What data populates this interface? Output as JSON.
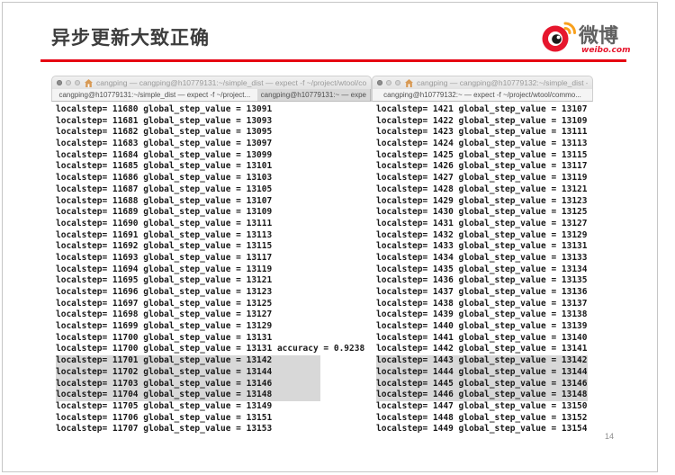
{
  "slide": {
    "title": "异步更新大致正确",
    "page_number": "14"
  },
  "colors": {
    "accent_red": "#e60012",
    "selection_highlight": "#d8d8d8",
    "orange_signal": "#f8a01c"
  },
  "logo": {
    "brand": "微博",
    "domain": "weibo.com"
  },
  "terminals": [
    {
      "window_title": "cangping — cangping@h10779131:~/simple_dist — expect -f ~/project/wtool/co",
      "tabs": [
        {
          "label": "cangping@h10779131:~/simple_dist — expect -f ~/project...",
          "active": true
        },
        {
          "label": "cangping@h10779131:~ — expe",
          "active": false
        }
      ],
      "lines": [
        "localstep= 11680 global_step_value = 13091",
        "localstep= 11681 global_step_value = 13093",
        "localstep= 11682 global_step_value = 13095",
        "localstep= 11683 global_step_value = 13097",
        "localstep= 11684 global_step_value = 13099",
        "localstep= 11685 global_step_value = 13101",
        "localstep= 11686 global_step_value = 13103",
        "localstep= 11687 global_step_value = 13105",
        "localstep= 11688 global_step_value = 13107",
        "localstep= 11689 global_step_value = 13109",
        "localstep= 11690 global_step_value = 13111",
        "localstep= 11691 global_step_value = 13113",
        "localstep= 11692 global_step_value = 13115",
        "localstep= 11693 global_step_value = 13117",
        "localstep= 11694 global_step_value = 13119",
        "localstep= 11695 global_step_value = 13121",
        "localstep= 11696 global_step_value = 13123",
        "localstep= 11697 global_step_value = 13125",
        "localstep= 11698 global_step_value = 13127",
        "localstep= 11699 global_step_value = 13129",
        "localstep= 11700 global_step_value = 13131",
        "localstep= 11700 global_step_value = 13131 accuracy = 0.9238",
        "localstep= 11701 global_step_value = 13142",
        "localstep= 11702 global_step_value = 13144",
        "localstep= 11703 global_step_value = 13146",
        "localstep= 11704 global_step_value = 13148",
        "localstep= 11705 global_step_value = 13149",
        "localstep= 11706 global_step_value = 13151",
        "localstep= 11707 global_step_value = 13153"
      ],
      "highlight_rows": [
        22,
        23,
        24,
        25
      ]
    },
    {
      "window_title": "cangping — cangping@h10779132:~/simple_dist —",
      "tabs": [
        {
          "label": "cangping@h10779132:~ — expect -f ~/project/wtool/commo...",
          "active": true
        }
      ],
      "lines": [
        "localstep= 1421 global_step_value = 13107",
        "localstep= 1422 global_step_value = 13109",
        "localstep= 1423 global_step_value = 13111",
        "localstep= 1424 global_step_value = 13113",
        "localstep= 1425 global_step_value = 13115",
        "localstep= 1426 global_step_value = 13117",
        "localstep= 1427 global_step_value = 13119",
        "localstep= 1428 global_step_value = 13121",
        "localstep= 1429 global_step_value = 13123",
        "localstep= 1430 global_step_value = 13125",
        "localstep= 1431 global_step_value = 13127",
        "localstep= 1432 global_step_value = 13129",
        "localstep= 1433 global_step_value = 13131",
        "localstep= 1434 global_step_value = 13133",
        "localstep= 1435 global_step_value = 13134",
        "localstep= 1436 global_step_value = 13135",
        "localstep= 1437 global_step_value = 13136",
        "localstep= 1438 global_step_value = 13137",
        "localstep= 1439 global_step_value = 13138",
        "localstep= 1440 global_step_value = 13139",
        "localstep= 1441 global_step_value = 13140",
        "localstep= 1442 global_step_value = 13141",
        "localstep= 1443 global_step_value = 13142",
        "localstep= 1444 global_step_value = 13144",
        "localstep= 1445 global_step_value = 13146",
        "localstep= 1446 global_step_value = 13148",
        "localstep= 1447 global_step_value = 13150",
        "localstep= 1448 global_step_value = 13152",
        "localstep= 1449 global_step_value = 13154"
      ],
      "highlight_rows": [
        22,
        23,
        24,
        25
      ]
    }
  ]
}
